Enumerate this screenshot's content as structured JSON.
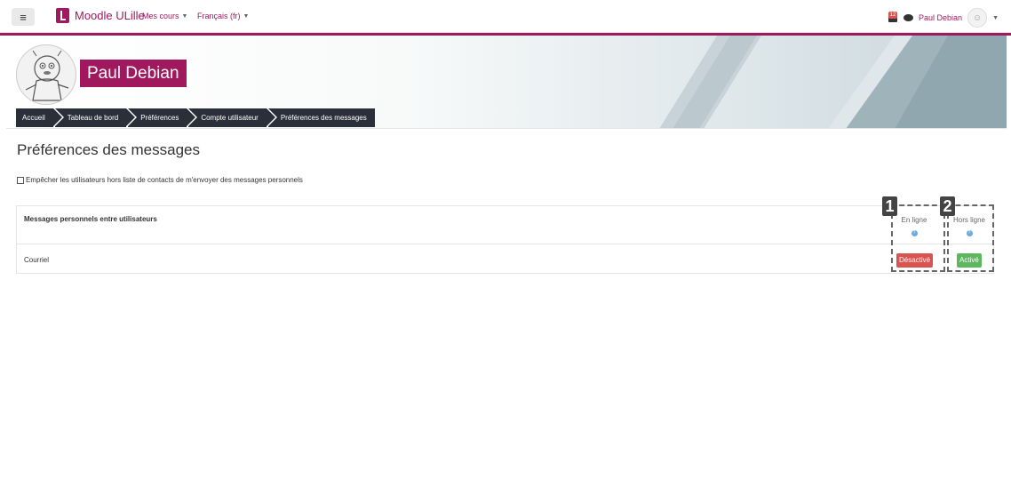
{
  "navbar": {
    "menu_icon": "hamburger-icon",
    "brand_name": "Moodle ULille",
    "menu_courses": "Mes cours",
    "menu_language": "Français (fr)",
    "notification_count": "12",
    "user_name": "Paul Debian"
  },
  "header": {
    "user_name": "Paul Debian",
    "breadcrumb": [
      "Accueil",
      "Tableau de bord",
      "Préférences",
      "Compte utilisateur",
      "Préférences des messages"
    ]
  },
  "main": {
    "title": "Préférences des messages",
    "block_non_contacts_label": "Empêcher les utilisateurs hors liste de contacts de m'envoyer des messages personnels",
    "table": {
      "section_label": "Messages personnels entre utilisateurs",
      "col_online": "En ligne",
      "col_offline": "Hors ligne",
      "row_label": "Courriel",
      "online_state": "Désactivé",
      "offline_state": "Activé"
    }
  },
  "annotations": {
    "marker_1": "1",
    "marker_2": "2"
  },
  "colors": {
    "brand": "#a0185e",
    "breadcrumb_bg": "#2b2f3a",
    "disabled": "#d9534f",
    "enabled": "#5cb85c"
  }
}
